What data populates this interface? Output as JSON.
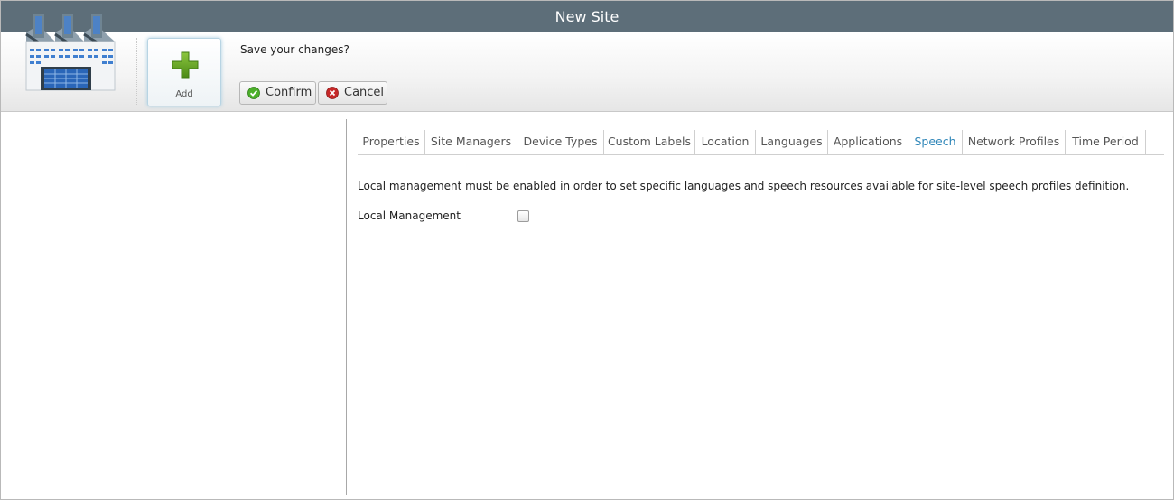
{
  "window": {
    "title": "New Site"
  },
  "toolbar": {
    "add_label": "Add",
    "save_prompt": "Save your changes?",
    "confirm_label": "Confirm",
    "cancel_label": "Cancel"
  },
  "tabs": [
    {
      "label": "Properties",
      "active": false
    },
    {
      "label": "Site Managers",
      "active": false
    },
    {
      "label": "Device Types",
      "active": false
    },
    {
      "label": "Custom Labels",
      "active": false
    },
    {
      "label": "Location",
      "active": false
    },
    {
      "label": "Languages",
      "active": false
    },
    {
      "label": "Applications",
      "active": false
    },
    {
      "label": "Speech",
      "active": true
    },
    {
      "label": "Network Profiles",
      "active": false
    },
    {
      "label": "Time Period",
      "active": false
    }
  ],
  "speech": {
    "info_text": "Local management must be enabled in order to set specific languages and speech resources available for site-level speech profiles definition.",
    "local_management_label": "Local Management",
    "local_management_checked": false
  },
  "colors": {
    "titlebar": "#5d6e79",
    "active_tab": "#2f86b8",
    "confirm_icon": "#4caf2a",
    "cancel_icon": "#c62828",
    "add_icon": "#5a9a1e"
  }
}
